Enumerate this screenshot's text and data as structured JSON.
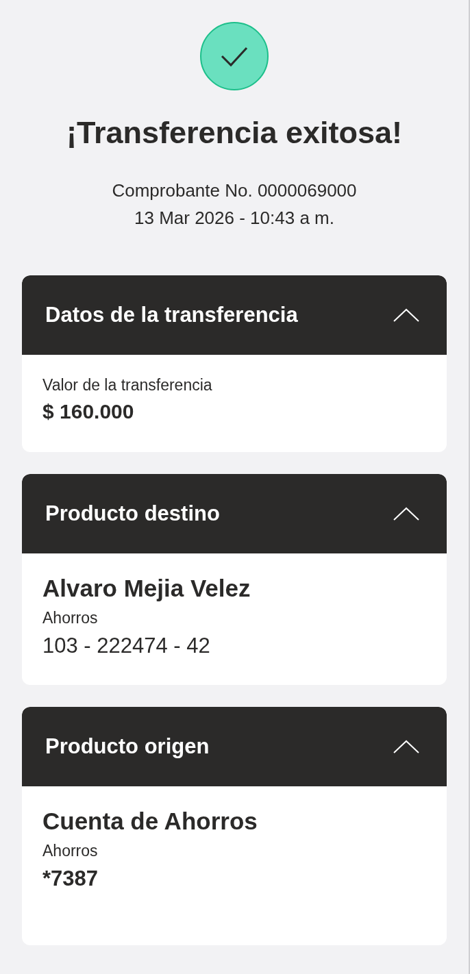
{
  "status": {
    "title": "¡Transferencia exitosa!",
    "receipt": "Comprobante No. 0000069000",
    "datetime": "13 Mar 2026 - 10:43 a m."
  },
  "sections": [
    {
      "kind": "amount",
      "title": "Datos de la transferencia",
      "expanded": true,
      "label": "Valor de la transferencia",
      "value": "$ 160.000"
    },
    {
      "kind": "product",
      "title": "Producto destino",
      "expanded": true,
      "name": "Alvaro Mejia Velez",
      "type": "Ahorros",
      "number": "103 - 222474 - 42"
    },
    {
      "kind": "product",
      "title": "Producto origen",
      "expanded": true,
      "name": "Cuenta de Ahorros",
      "type": "Ahorros",
      "number": "*7387"
    }
  ]
}
